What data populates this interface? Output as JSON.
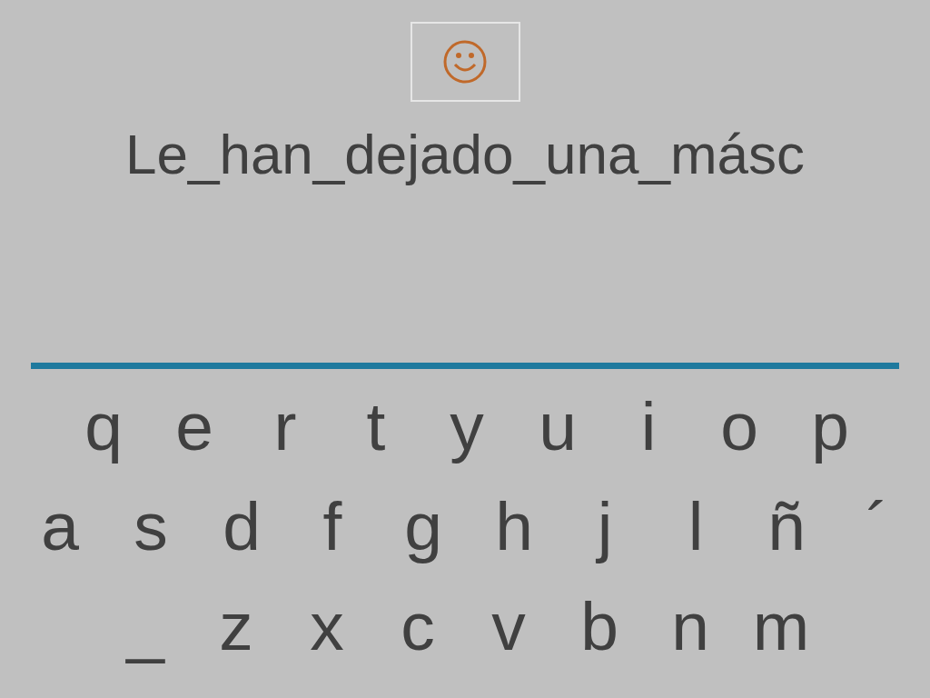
{
  "feedback": {
    "kind": "smiley"
  },
  "phrase": "Le_han_dejado_una_másc",
  "keyboard": {
    "rows": [
      {
        "keys": [
          "q",
          "e",
          "r",
          "t",
          "y",
          "u",
          "i",
          "o",
          "p"
        ]
      },
      {
        "keys": [
          "a",
          "s",
          "d",
          "f",
          "g",
          "h",
          "j",
          "l",
          "ñ",
          "´"
        ]
      },
      {
        "keys": [
          "_",
          "z",
          "x",
          "c",
          "v",
          "b",
          "n",
          "m"
        ]
      }
    ]
  }
}
